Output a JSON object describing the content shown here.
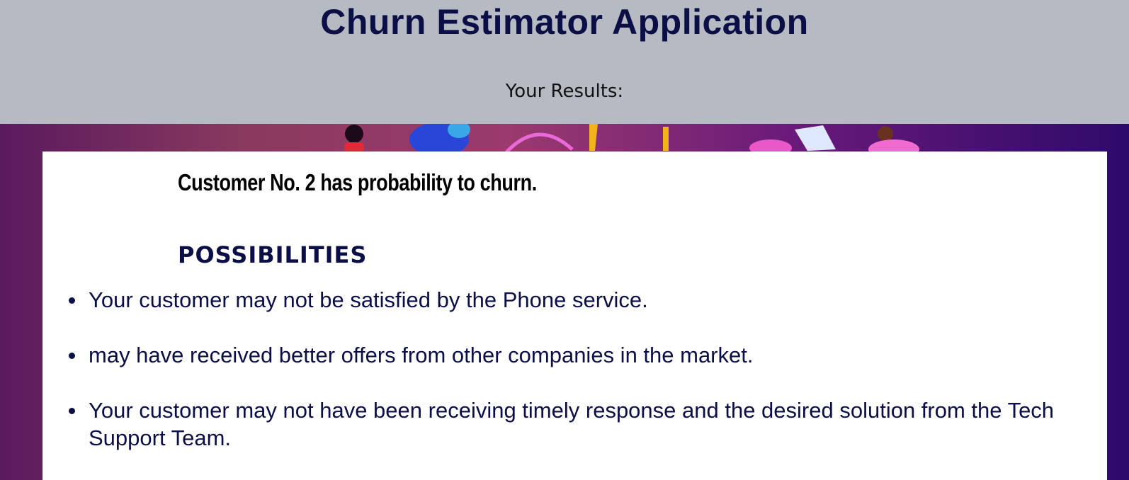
{
  "header": {
    "title": "Churn Estimator Application",
    "results_label": "Your Results:"
  },
  "result": {
    "verdict": "Customer No. 2 has probability to churn.",
    "possibilities_heading": "POSSIBILITIES",
    "reasons": [
      "Your customer may not be satisfied by the Phone service.",
      "may have received better offers from other companies in the market.",
      "Your customer may not have been receiving timely response and the desired solution from the Tech Support Team."
    ]
  }
}
